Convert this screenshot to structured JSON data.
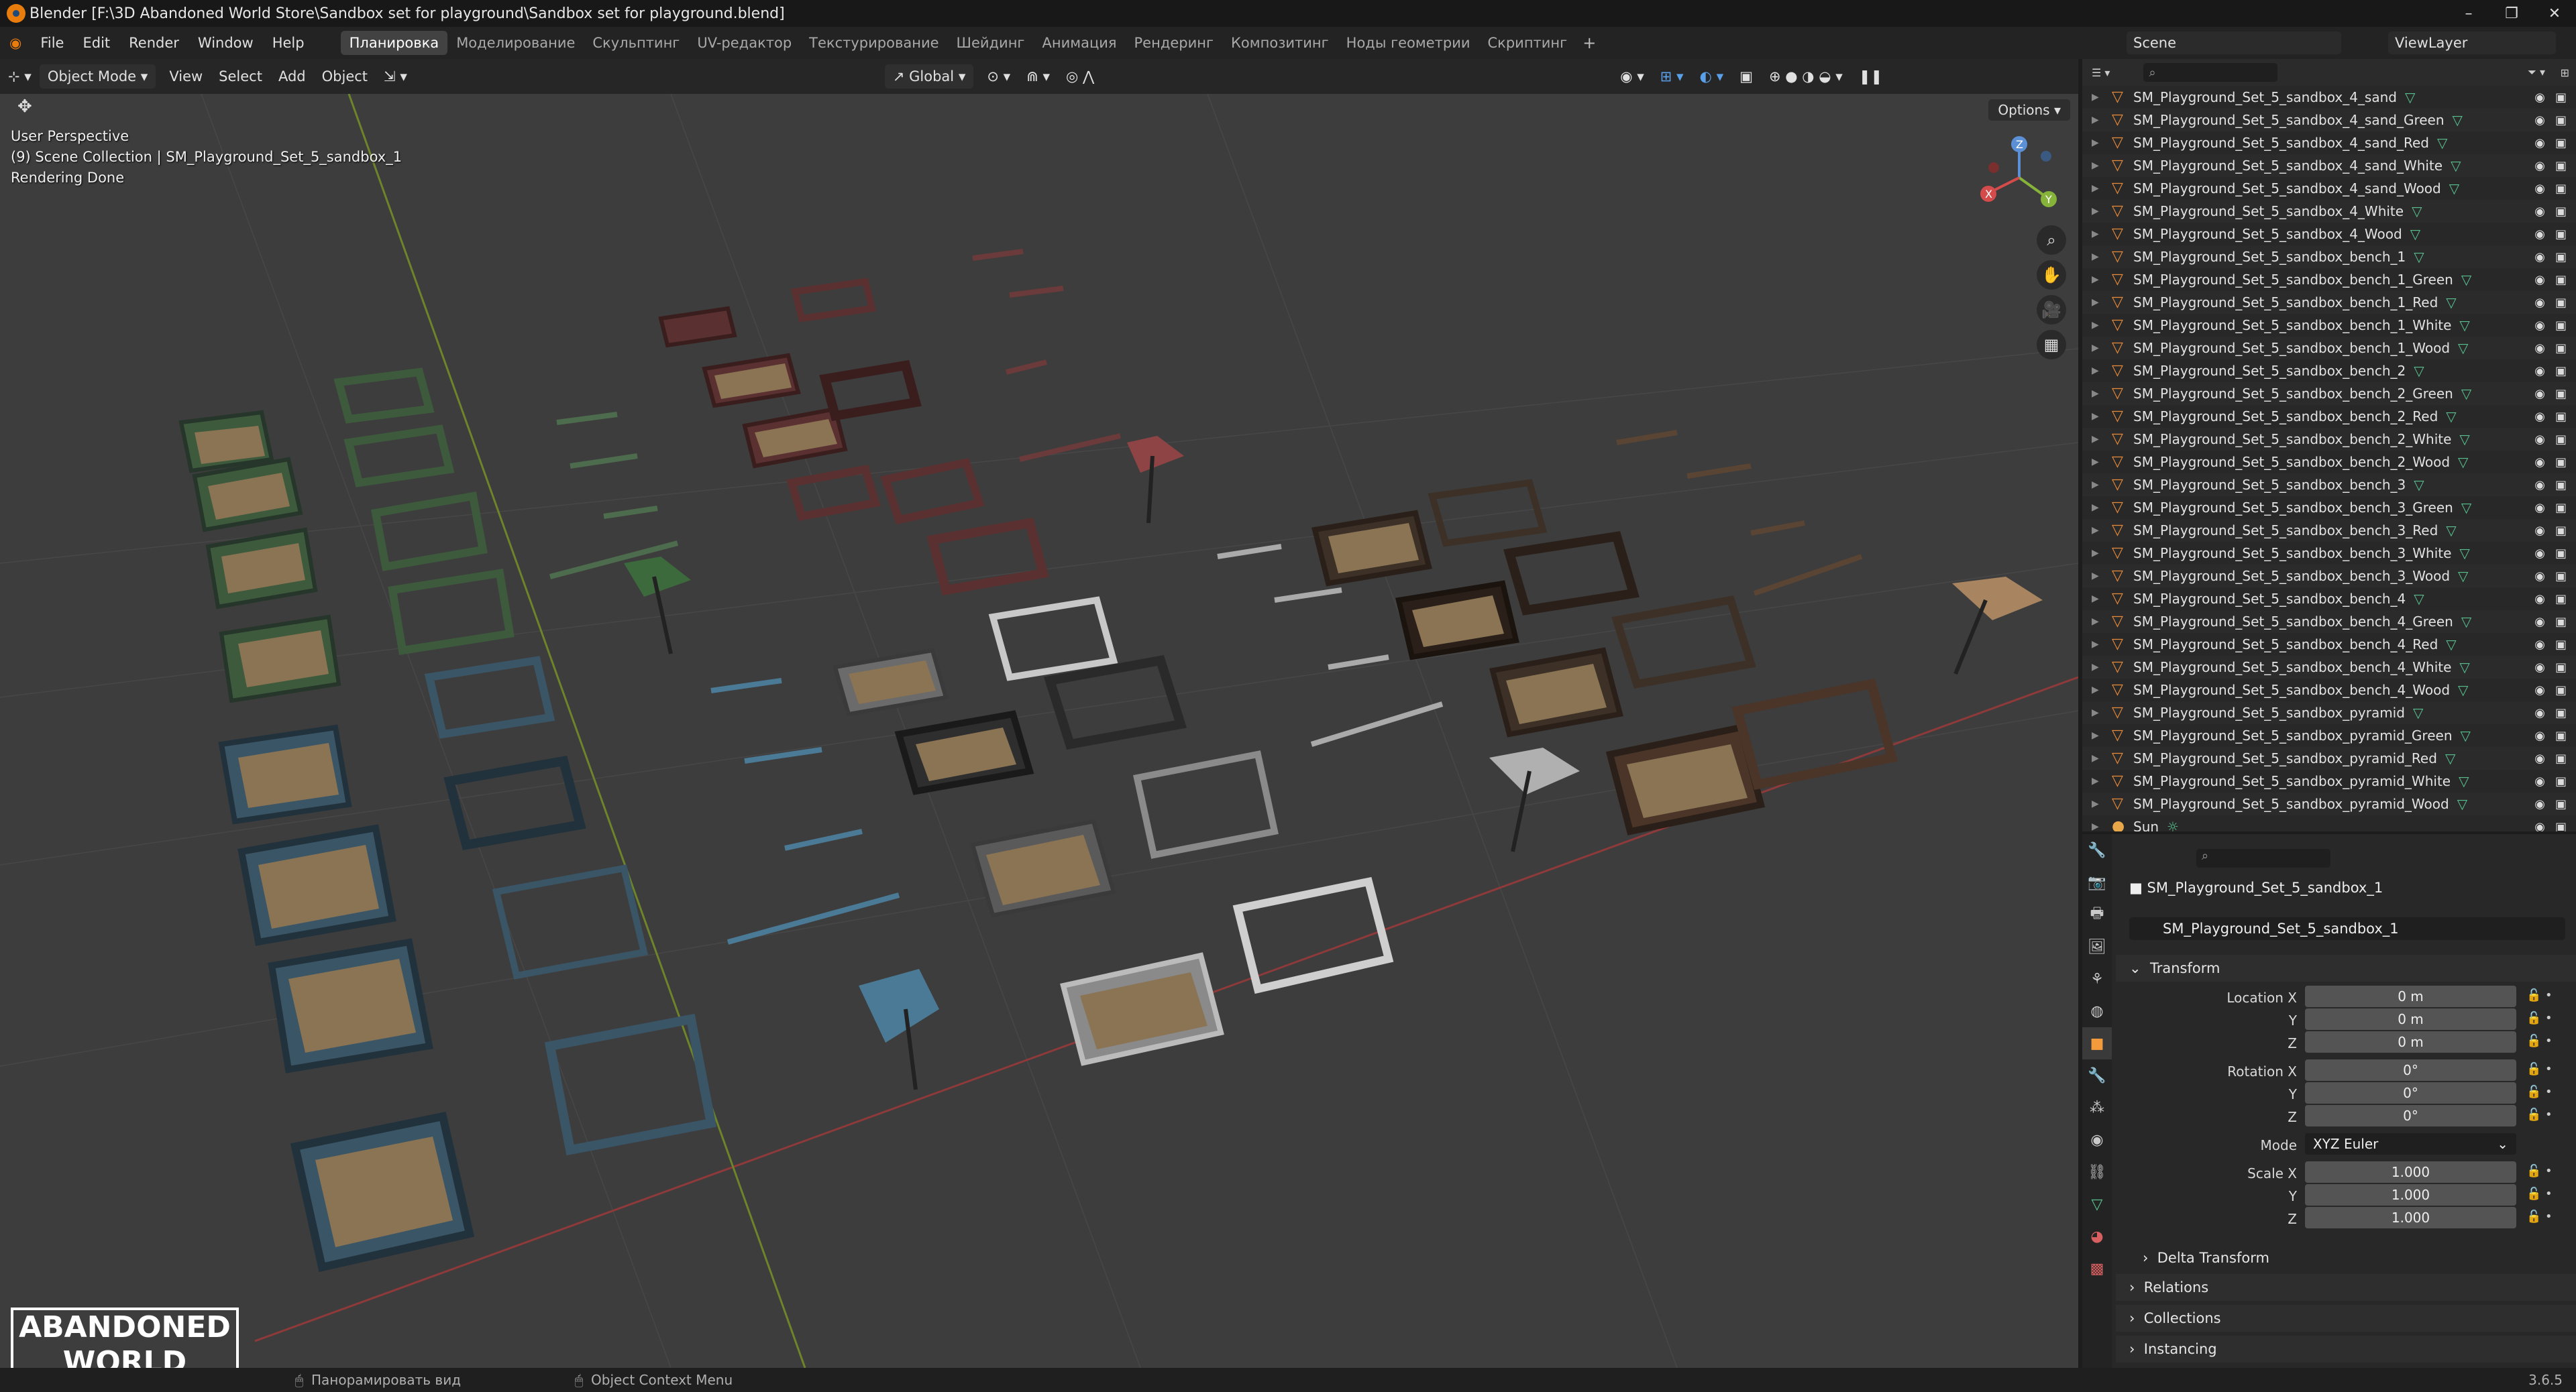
{
  "window": {
    "title": "Blender [F:\\3D Abandoned World Store\\Sandbox set for playground\\Sandbox set for playground.blend]"
  },
  "menus": [
    "File",
    "Edit",
    "Render",
    "Window",
    "Help"
  ],
  "workspaces": [
    "Планировка",
    "Моделирование",
    "Скульптинг",
    "UV-редактор",
    "Текстурирование",
    "Шейдинг",
    "Анимация",
    "Рендеринг",
    "Композитинг",
    "Ноды геометрии",
    "Скриптинг"
  ],
  "active_workspace_index": 0,
  "scene": {
    "name": "Scene",
    "view_layer": "ViewLayer"
  },
  "viewport_header": {
    "mode": "Object Mode",
    "menus": [
      "View",
      "Select",
      "Add",
      "Object"
    ],
    "transform_orientation": "Global",
    "options_label": "Options"
  },
  "viewport_info": {
    "line1": "User Perspective",
    "line2": "(9) Scene Collection | SM_Playground_Set_5_sandbox_1",
    "line3": "Rendering Done"
  },
  "outliner": {
    "rows": [
      {
        "name": "SM_Playground_Set_5_sandbox_4_sand"
      },
      {
        "name": "SM_Playground_Set_5_sandbox_4_sand_Green"
      },
      {
        "name": "SM_Playground_Set_5_sandbox_4_sand_Red"
      },
      {
        "name": "SM_Playground_Set_5_sandbox_4_sand_White"
      },
      {
        "name": "SM_Playground_Set_5_sandbox_4_sand_Wood"
      },
      {
        "name": "SM_Playground_Set_5_sandbox_4_White"
      },
      {
        "name": "SM_Playground_Set_5_sandbox_4_Wood"
      },
      {
        "name": "SM_Playground_Set_5_sandbox_bench_1"
      },
      {
        "name": "SM_Playground_Set_5_sandbox_bench_1_Green"
      },
      {
        "name": "SM_Playground_Set_5_sandbox_bench_1_Red"
      },
      {
        "name": "SM_Playground_Set_5_sandbox_bench_1_White"
      },
      {
        "name": "SM_Playground_Set_5_sandbox_bench_1_Wood"
      },
      {
        "name": "SM_Playground_Set_5_sandbox_bench_2"
      },
      {
        "name": "SM_Playground_Set_5_sandbox_bench_2_Green"
      },
      {
        "name": "SM_Playground_Set_5_sandbox_bench_2_Red"
      },
      {
        "name": "SM_Playground_Set_5_sandbox_bench_2_White"
      },
      {
        "name": "SM_Playground_Set_5_sandbox_bench_2_Wood"
      },
      {
        "name": "SM_Playground_Set_5_sandbox_bench_3"
      },
      {
        "name": "SM_Playground_Set_5_sandbox_bench_3_Green"
      },
      {
        "name": "SM_Playground_Set_5_sandbox_bench_3_Red"
      },
      {
        "name": "SM_Playground_Set_5_sandbox_bench_3_White"
      },
      {
        "name": "SM_Playground_Set_5_sandbox_bench_3_Wood"
      },
      {
        "name": "SM_Playground_Set_5_sandbox_bench_4"
      },
      {
        "name": "SM_Playground_Set_5_sandbox_bench_4_Green"
      },
      {
        "name": "SM_Playground_Set_5_sandbox_bench_4_Red"
      },
      {
        "name": "SM_Playground_Set_5_sandbox_bench_4_White"
      },
      {
        "name": "SM_Playground_Set_5_sandbox_bench_4_Wood"
      },
      {
        "name": "SM_Playground_Set_5_sandbox_pyramid"
      },
      {
        "name": "SM_Playground_Set_5_sandbox_pyramid_Green"
      },
      {
        "name": "SM_Playground_Set_5_sandbox_pyramid_Red"
      },
      {
        "name": "SM_Playground_Set_5_sandbox_pyramid_White"
      },
      {
        "name": "SM_Playground_Set_5_sandbox_pyramid_Wood"
      },
      {
        "name": "Sun"
      }
    ]
  },
  "properties": {
    "object_name": "SM_Playground_Set_5_sandbox_1",
    "object_field": "SM_Playground_Set_5_sandbox_1",
    "panels": {
      "transform": "Transform",
      "delta": "Delta Transform",
      "relations": "Relations",
      "collections": "Collections",
      "instancing": "Instancing"
    },
    "location": {
      "label": "Location X",
      "x": "0 m",
      "y": "0 m",
      "z": "0 m"
    },
    "rotation": {
      "label": "Rotation X",
      "x": "0°",
      "y": "0°",
      "z": "0°"
    },
    "mode": {
      "label": "Mode",
      "value": "XYZ Euler"
    },
    "scale": {
      "label": "Scale X",
      "x": "1.000",
      "y": "1.000",
      "z": "1.000"
    },
    "axis_y": "Y",
    "axis_z": "Z"
  },
  "statusbar": {
    "pan": "Панорамировать вид",
    "context": "Object Context Menu",
    "version": "3.6.5"
  },
  "watermark": {
    "line1": "ABANDONED",
    "line2": "WORLD"
  },
  "colors": {
    "accent": "#e87d0d",
    "active_ws": "#424242",
    "grid_red": "#9b3b3b",
    "grid_green": "#6f8a2c",
    "viewport_bg": "#3d3d3d"
  }
}
